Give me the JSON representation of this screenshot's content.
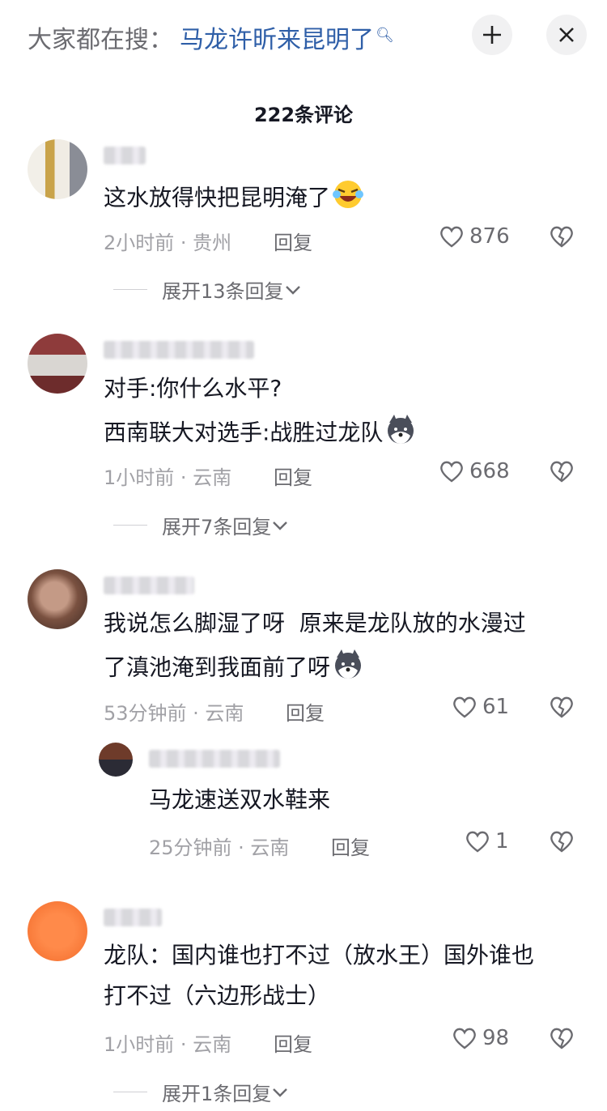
{
  "search": {
    "prefix": "大家都在搜：",
    "query": "马龙许昕来昆明了"
  },
  "header": {
    "count": "222条评论"
  },
  "comments": [
    {
      "text_lines": [
        "这水放得快把昆明淹了"
      ],
      "emoji": "laughing-tears-emoji",
      "time_place": "2小时前 · 贵州",
      "reply": "回复",
      "likes": "876",
      "expand": "展开13条回复"
    },
    {
      "text_lines": [
        "对手:你什么水平?",
        "西南联大对选手:战胜过龙队"
      ],
      "emoji": "husky-emoji",
      "time_place": "1小时前 · 云南",
      "reply": "回复",
      "likes": "668",
      "expand": "展开7条回复"
    },
    {
      "text_lines": [
        "我说怎么脚湿了呀  原来是龙队放的水漫过",
        "了滇池淹到我面前了呀"
      ],
      "emoji": "husky-emoji",
      "time_place": "53分钟前 · 云南",
      "reply": "回复",
      "likes": "61",
      "replies": [
        {
          "text_lines": [
            "马龙速送双水鞋来"
          ],
          "time_place": "25分钟前 · 云南",
          "reply": "回复",
          "likes": "1"
        }
      ]
    },
    {
      "text_lines": [
        "龙队：国内谁也打不过（放水王）国外谁也",
        "打不过（六边形战士）"
      ],
      "time_place": "1小时前 · 云南",
      "reply": "回复",
      "likes": "98",
      "expand": "展开1条回复"
    }
  ],
  "colors": {
    "link": "#2f5fa8",
    "text": "#161823",
    "muted": "#a1a1a6"
  }
}
